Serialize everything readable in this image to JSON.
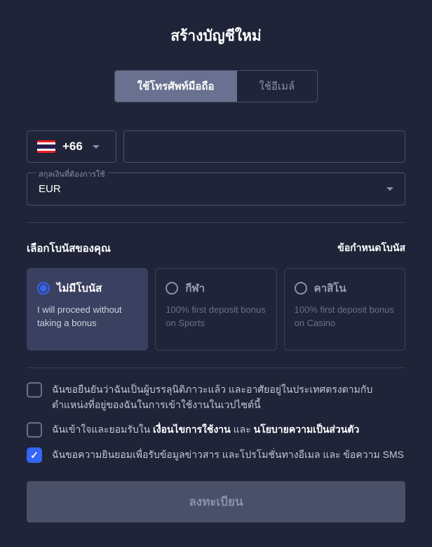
{
  "title": "สร้างบัญชีใหม่",
  "tabs": {
    "phone": "ใช้โทรศัพท์มือถือ",
    "email": "ใช้อีเมล์"
  },
  "country": {
    "code": "+66"
  },
  "currency": {
    "label": "สกุลเงินที่ต้องการใช้",
    "value": "EUR"
  },
  "bonus": {
    "heading": "เลือกโบนัสของคุณ",
    "terms": "ข้อกำหนดโบนัส",
    "options": [
      {
        "name": "ไม่มีโบนัส",
        "desc": "I will proceed without taking a bonus"
      },
      {
        "name": "กีฬา",
        "desc": "100% first deposit bonus on Sports"
      },
      {
        "name": "คาสิโน",
        "desc": "100% first deposit bonus on Casino"
      }
    ]
  },
  "checks": {
    "age": "ฉันขอยืนยันว่าฉันเป็นผู้บรรลุนิติภาวะแล้ว และอาศัยอยู่ในประเทศตรงตามกับตำแหน่งที่อยู่ของฉันในการเข้าใช้งานในเวปไซต์นี้",
    "terms_prefix": "ฉันเข้าใจและยอมรับใน ",
    "terms_link": "เงื่อนไขการใช้งาน",
    "terms_and": " และ ",
    "privacy_link": "นโยบายความเป็นส่วนตัว",
    "marketing": "ฉันขอความยินยอมเพื่อรับข้อมูลข่าวสาร และโปรโมชั่นทางอีเมล และ ข้อความ SMS"
  },
  "submit": "ลงทะเบียน"
}
